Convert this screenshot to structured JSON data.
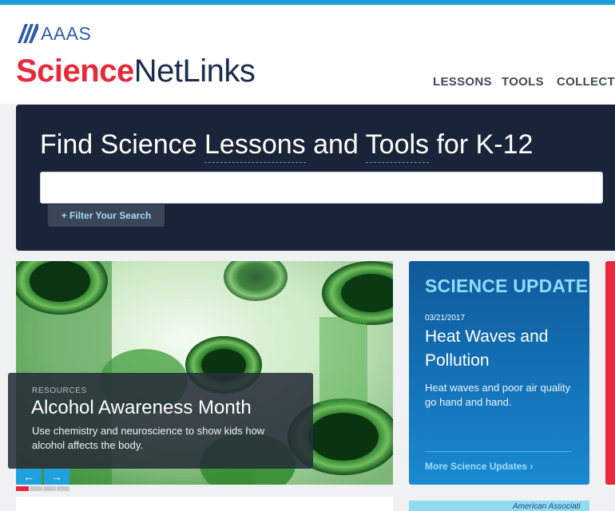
{
  "brand": {
    "org": "AAAS",
    "name_part1": "Science",
    "name_part2": "NetLinks"
  },
  "nav": {
    "items": [
      "LESSONS",
      "TOOLS",
      "COLLECTIO"
    ]
  },
  "hero": {
    "title_prefix": "Find Science ",
    "title_lessons": "Lessons",
    "title_and": " and ",
    "title_tools": "Tools",
    "title_suffix": " for K-12",
    "search_value": "",
    "filter_button": "+ Filter Your Search"
  },
  "feature": {
    "tag": "RESOURCES",
    "title": "Alcohol Awareness Month",
    "description": "Use chemistry and neuroscience to show kids how alcohol affects the body.",
    "prev_arrow": "←",
    "next_arrow": "→",
    "slide_count": 4,
    "active_slide": 1
  },
  "science_update": {
    "heading": "SCIENCE UPDATE",
    "date": "03/21/2017",
    "title": "Heat Waves and Pollution",
    "description": "Heat waves and poor air quality go hand and hand.",
    "more_link": "More Science Updates ›"
  },
  "bottom_teaser": {
    "text": "American Associati"
  },
  "colors": {
    "accent_red": "#e8283b",
    "navy": "#1a2438",
    "update_blue": "#1473b9",
    "light_blue": "#8fdcff",
    "top_bar": "#1a9fd8"
  }
}
